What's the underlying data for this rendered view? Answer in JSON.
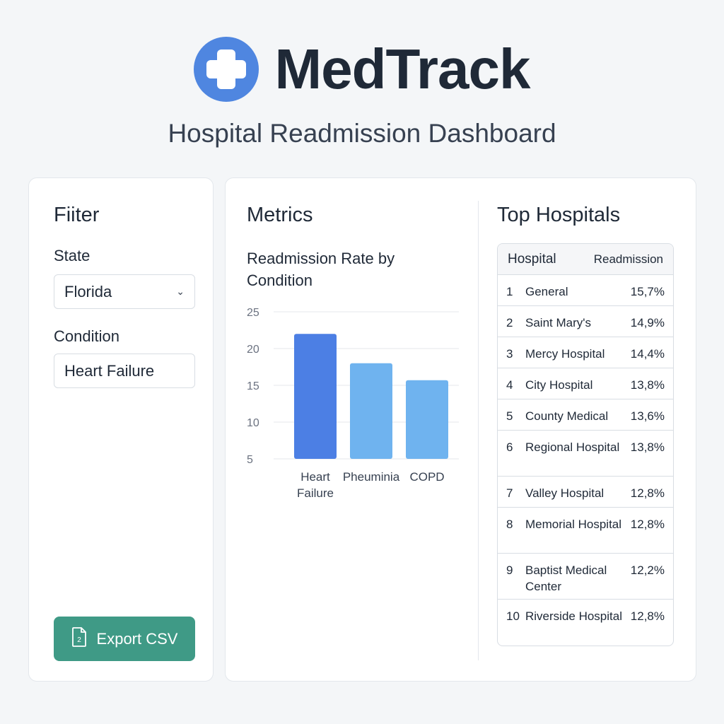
{
  "brand": {
    "name": "MedTrack",
    "subtitle": "Hospital Readmission Dashboard",
    "accent_color": "#4f86e0",
    "logo_icon": "medical-cross-icon"
  },
  "filter": {
    "title": "Fiiter",
    "state_label": "State",
    "state_value": "Florida",
    "condition_label": "Condition",
    "condition_value": "Heart Failure",
    "export_label": "Export CSV",
    "export_icon": "csv-file-icon",
    "export_color": "#3f9a86"
  },
  "metrics": {
    "title": "Metrics",
    "chart_title": "Readmission Rate by Condition"
  },
  "chart_data": {
    "type": "bar",
    "title": "Readmission Rate by Condition",
    "categories": [
      "Heart Failure",
      "Pheuminia",
      "COPD"
    ],
    "values": [
      22,
      18,
      15.7
    ],
    "ylim": [
      5,
      25
    ],
    "yticks": [
      25,
      20,
      15,
      10,
      5
    ],
    "grid": true,
    "bar_colors": [
      "#4c7fe4",
      "#6fb3ef",
      "#6fb3ef"
    ]
  },
  "top_hospitals": {
    "title": "Top Hospitals",
    "headers": [
      "Hospital",
      "Readmission"
    ],
    "rows": [
      {
        "rank": "1",
        "name": "General",
        "rate": "15,7%"
      },
      {
        "rank": "2",
        "name": "Saint Mary's",
        "rate": "14,9%"
      },
      {
        "rank": "3",
        "name": "Mercy Hospital",
        "rate": "14,4%"
      },
      {
        "rank": "4",
        "name": "City Hospital",
        "rate": "13,8%"
      },
      {
        "rank": "5",
        "name": "County Medical",
        "rate": "13,6%"
      },
      {
        "rank": "6",
        "name": "Regional Hospital",
        "rate": "13,8%"
      },
      {
        "rank": "7",
        "name": "Valley Hospital",
        "rate": "12,8%"
      },
      {
        "rank": "8",
        "name": "Memorial Hospital",
        "rate": "12,8%"
      },
      {
        "rank": "9",
        "name": "Baptist Medical Center",
        "rate": "12,2%"
      },
      {
        "rank": "10",
        "name": "Riverside Hospital",
        "rate": "12,8%"
      }
    ]
  }
}
